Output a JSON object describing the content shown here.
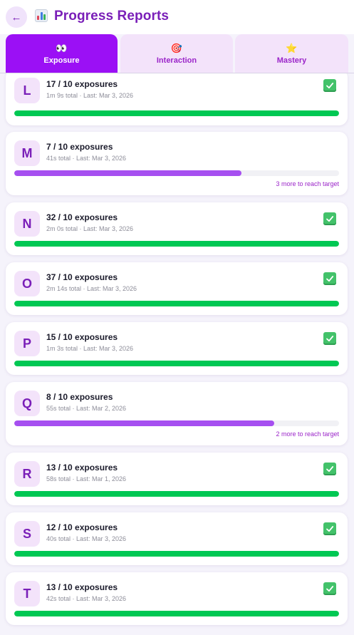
{
  "header": {
    "back_label": "←",
    "title": "Progress Reports",
    "title_icon": "bar-chart-icon"
  },
  "tabs": [
    {
      "label": "Exposure",
      "icon": "eyes-icon",
      "glyph": "👀",
      "active": true
    },
    {
      "label": "Interaction",
      "icon": "target-icon",
      "glyph": "🎯",
      "active": false
    },
    {
      "label": "Mastery",
      "icon": "star-icon",
      "glyph": "⭐",
      "active": false
    }
  ],
  "colors": {
    "accent": "#9b10f5",
    "complete": "#00c853",
    "incomplete": "#a64ff0",
    "track": "#f1f1f5",
    "check": "#43c26a"
  },
  "cards": [
    {
      "letter": "L",
      "count": "17 / 10 exposures",
      "meta": "1m 9s total · Last: Mar 3, 2026",
      "progress": 1.0,
      "complete": true,
      "hint": ""
    },
    {
      "letter": "M",
      "count": "7 / 10 exposures",
      "meta": "41s total · Last: Mar 3, 2026",
      "progress": 0.7,
      "complete": false,
      "hint": "3 more to reach target"
    },
    {
      "letter": "N",
      "count": "32 / 10 exposures",
      "meta": "2m 0s total · Last: Mar 3, 2026",
      "progress": 1.0,
      "complete": true,
      "hint": ""
    },
    {
      "letter": "O",
      "count": "37 / 10 exposures",
      "meta": "2m 14s total · Last: Mar 3, 2026",
      "progress": 1.0,
      "complete": true,
      "hint": ""
    },
    {
      "letter": "P",
      "count": "15 / 10 exposures",
      "meta": "1m 3s total · Last: Mar 3, 2026",
      "progress": 1.0,
      "complete": true,
      "hint": ""
    },
    {
      "letter": "Q",
      "count": "8 / 10 exposures",
      "meta": "55s total · Last: Mar 2, 2026",
      "progress": 0.8,
      "complete": false,
      "hint": "2 more to reach target"
    },
    {
      "letter": "R",
      "count": "13 / 10 exposures",
      "meta": "58s total · Last: Mar 1, 2026",
      "progress": 1.0,
      "complete": true,
      "hint": ""
    },
    {
      "letter": "S",
      "count": "12 / 10 exposures",
      "meta": "40s total · Last: Mar 3, 2026",
      "progress": 1.0,
      "complete": true,
      "hint": ""
    },
    {
      "letter": "T",
      "count": "13 / 10 exposures",
      "meta": "42s total · Last: Mar 3, 2026",
      "progress": 1.0,
      "complete": true,
      "hint": ""
    }
  ]
}
